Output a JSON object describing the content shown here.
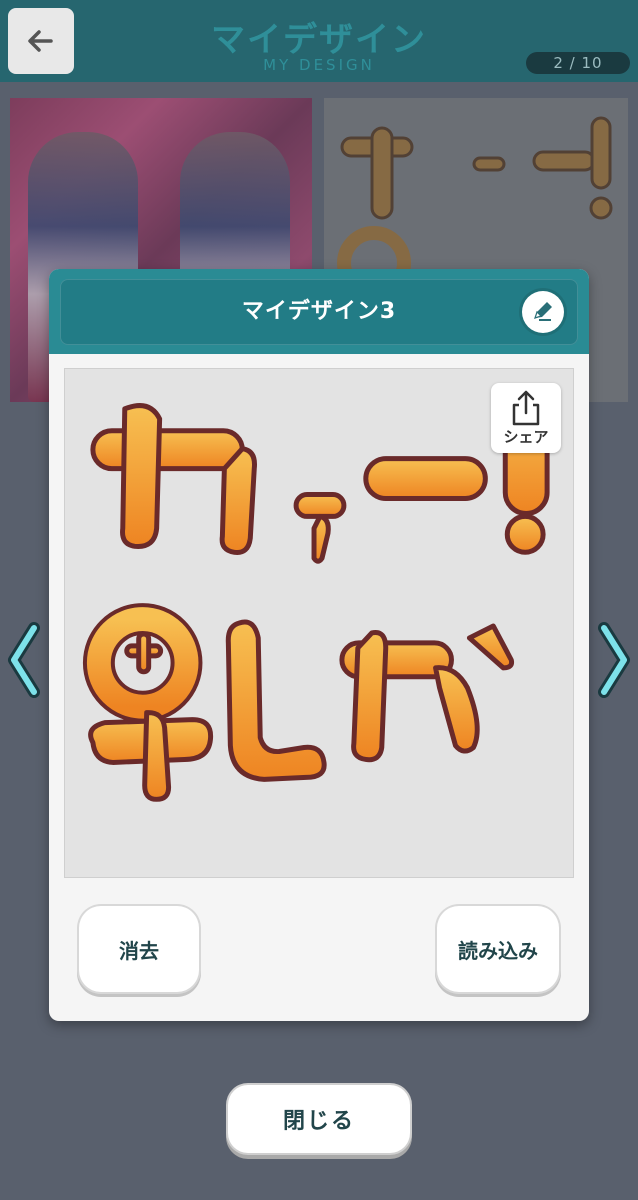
{
  "header": {
    "title": "マイデザイン",
    "subtitle": "MY DESIGN",
    "page_counter": "2 / 10",
    "back_icon": "arrow-left-icon"
  },
  "dialog": {
    "title": "マイデザイン3",
    "edit_icon": "pencil-icon",
    "share_label": "シェア",
    "share_icon": "share-upload-icon",
    "design_text_line1": "カァー!",
    "design_text_line2": "鬼しか",
    "erase_label": "消去",
    "load_label": "読み込み"
  },
  "close_label": "閉じる",
  "colors": {
    "header_bg": "#26666f",
    "accent_teal": "#2a8b94",
    "page_bg": "#59606d",
    "letter_orange": "#f2a13a",
    "letter_outline": "#6a2a2a"
  }
}
